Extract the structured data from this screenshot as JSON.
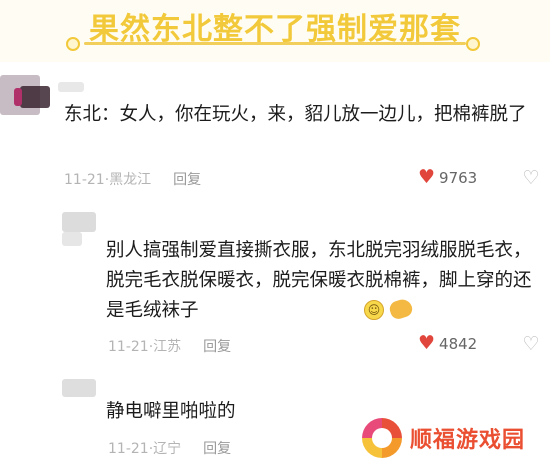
{
  "header": {
    "title": "果然东北整不了强制爱那套"
  },
  "comments": [
    {
      "text": "东北：女人，你在玩火，来，貂儿放一边儿，把棉裤脱了",
      "date": "11-21",
      "location": "黑龙江",
      "reply_label": "回复",
      "likes": "9763"
    },
    {
      "text": "别人搞强制爱直接撕衣服，东北脱完羽绒服脱毛衣，脱完毛衣脱保暖衣，脱完保暖衣脱棉裤，脚上穿的还是毛绒袜子",
      "date": "11-21",
      "location": "江苏",
      "reply_label": "回复",
      "likes": "4842"
    },
    {
      "text": "静电噼里啪啦的",
      "date": "11-21",
      "location": "辽宁",
      "reply_label": "回复"
    }
  ],
  "watermark": {
    "text": "顺福游戏园"
  },
  "colors": {
    "title": "#f2c93a",
    "heart": "#e0463c",
    "watermark": "#ea4f32"
  }
}
